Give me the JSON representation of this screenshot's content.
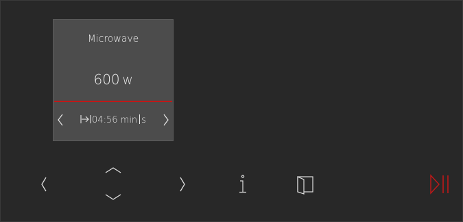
{
  "mode_card": {
    "title": "Microwave",
    "power_value": "600",
    "power_unit": "W",
    "time_value": "04:56",
    "time_unit_min": "min",
    "time_unit_s": "s"
  },
  "colors": {
    "background": "#282828",
    "card": "#4c4c4c",
    "accent_red": "#c01818",
    "text": "#ececec"
  },
  "controls": {
    "icons": [
      "chevron-left-icon",
      "chevron-up-icon",
      "chevron-down-icon",
      "chevron-right-icon",
      "info-icon",
      "door-icon",
      "play-pause-icon"
    ]
  }
}
